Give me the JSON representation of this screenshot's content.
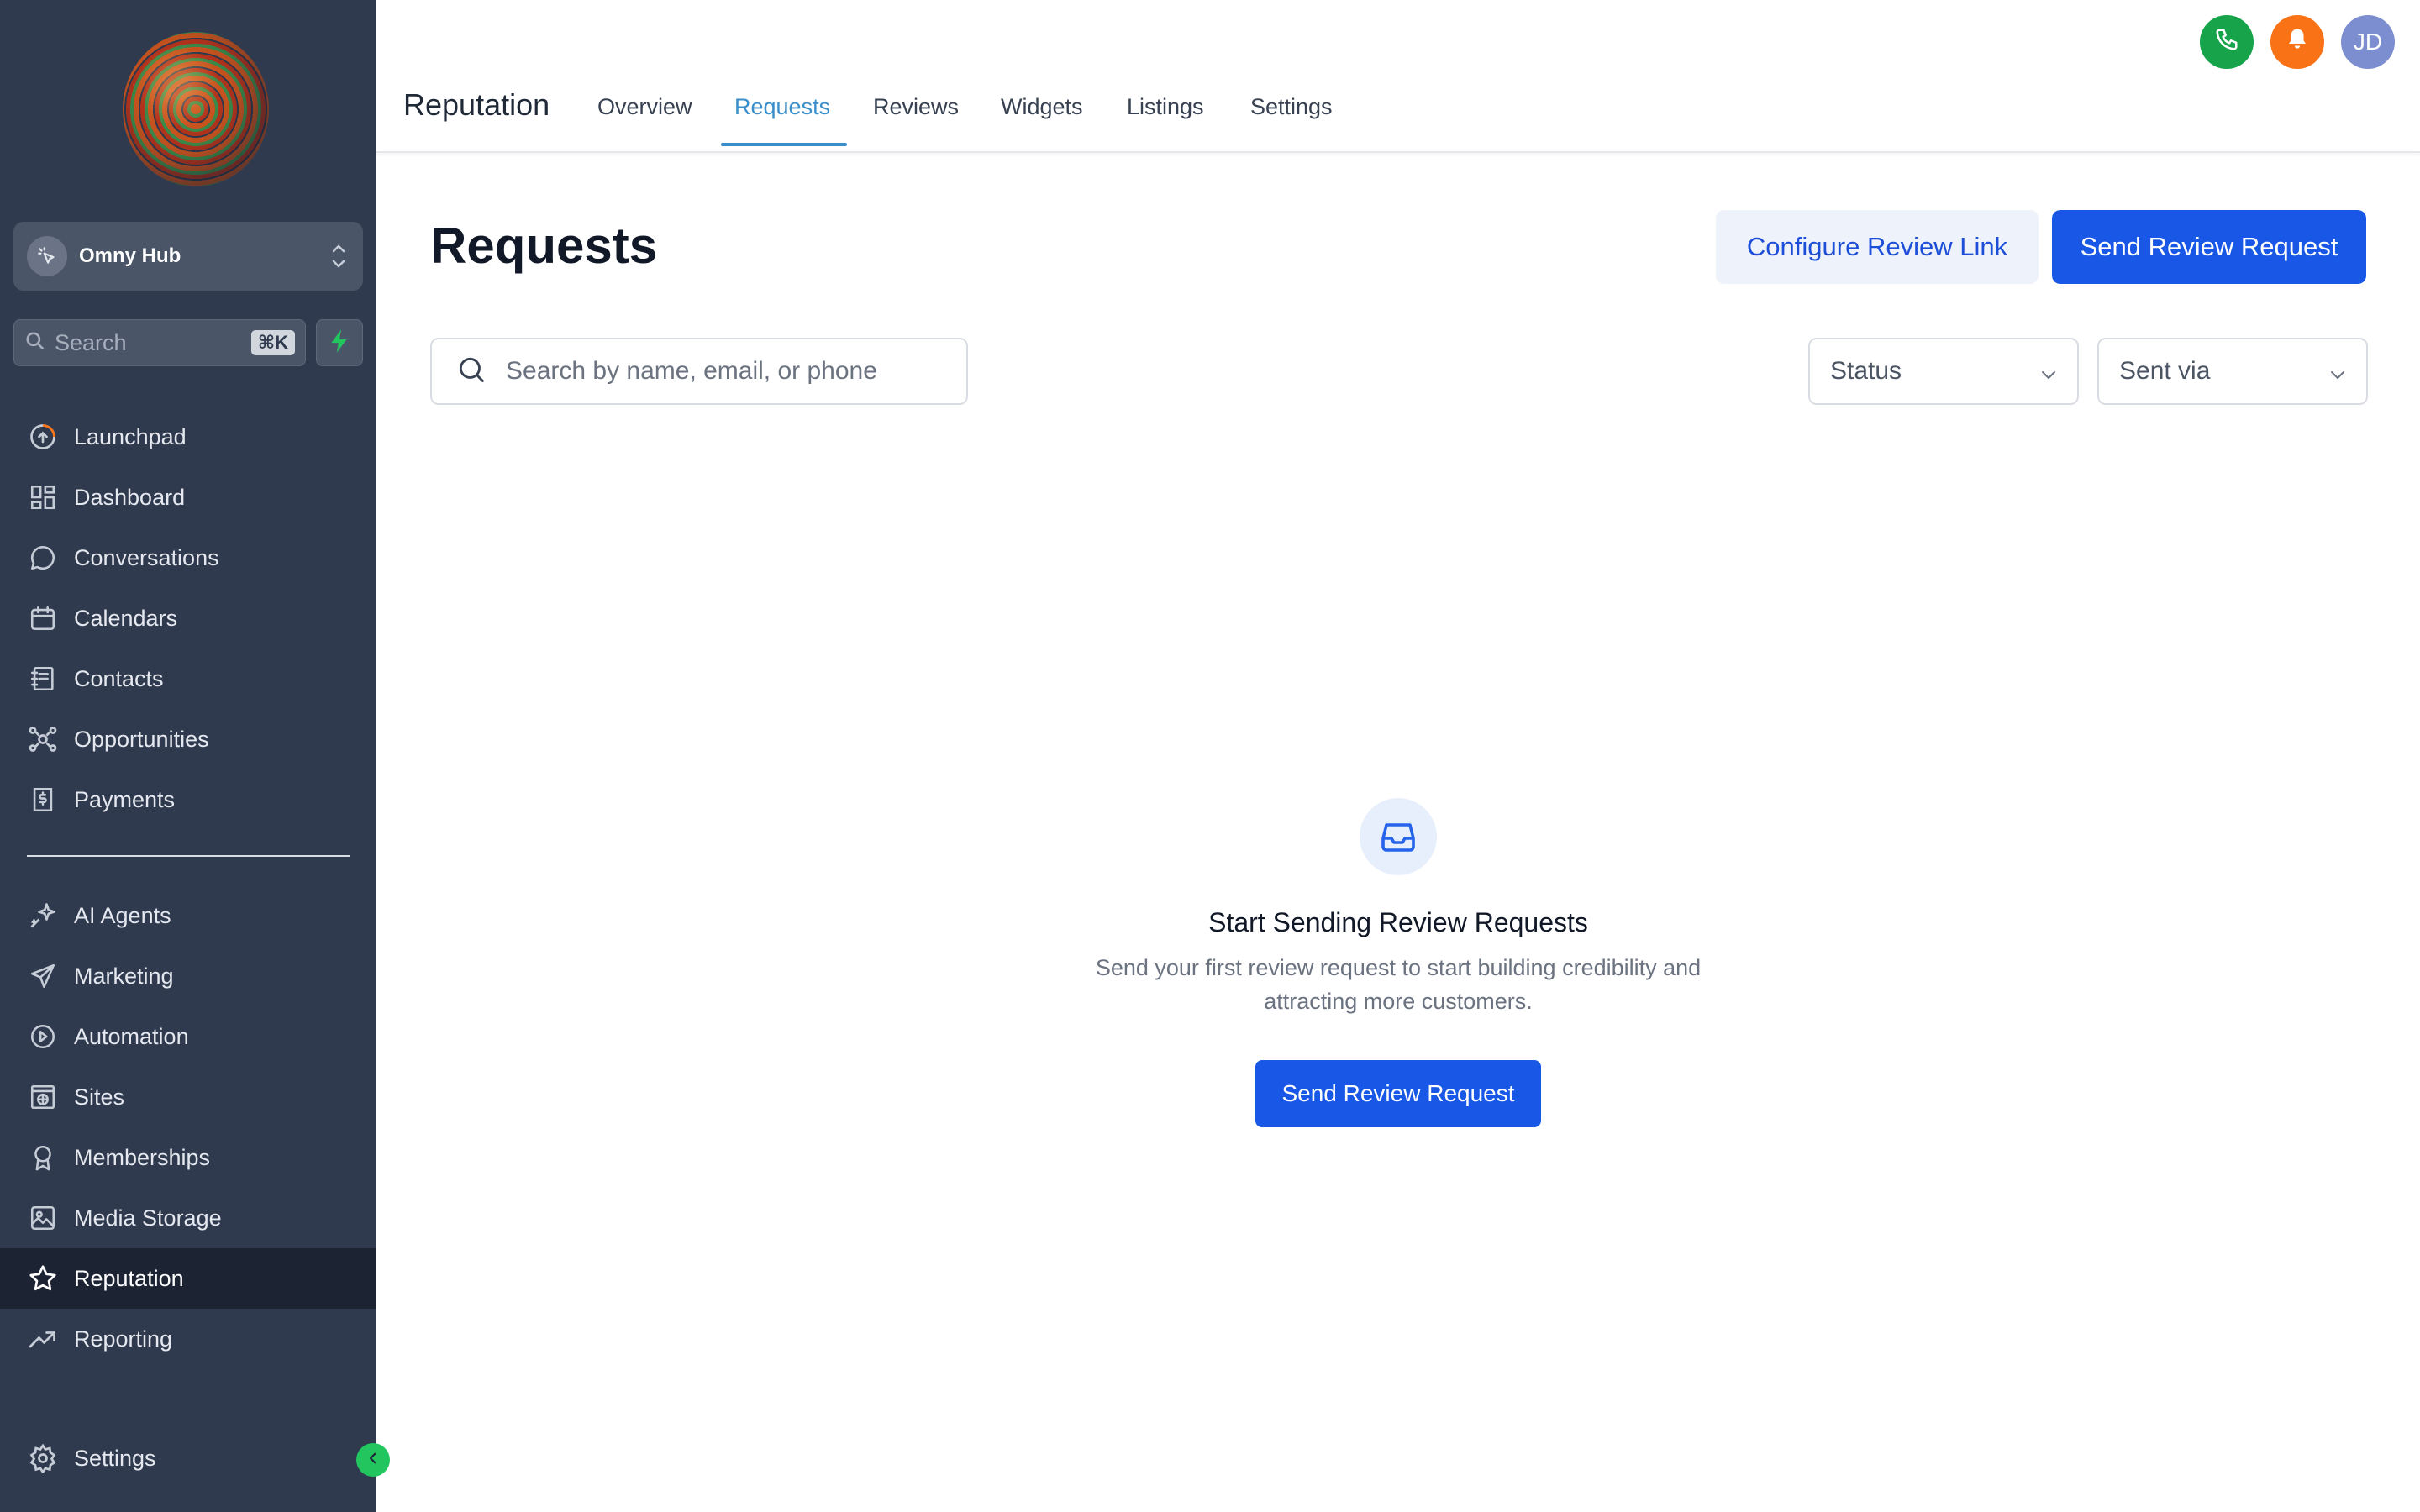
{
  "sidebar": {
    "account_name": "Omny Hub",
    "search_label": "Search",
    "search_shortcut": "⌘K",
    "nav_primary": [
      {
        "label": "Launchpad",
        "icon": "rocket-icon"
      },
      {
        "label": "Dashboard",
        "icon": "grid-icon"
      },
      {
        "label": "Conversations",
        "icon": "chat-icon"
      },
      {
        "label": "Calendars",
        "icon": "calendar-icon"
      },
      {
        "label": "Contacts",
        "icon": "contacts-icon"
      },
      {
        "label": "Opportunities",
        "icon": "opportunities-icon"
      },
      {
        "label": "Payments",
        "icon": "payments-icon"
      }
    ],
    "nav_secondary": [
      {
        "label": "AI Agents",
        "icon": "sparkle-icon"
      },
      {
        "label": "Marketing",
        "icon": "send-icon"
      },
      {
        "label": "Automation",
        "icon": "play-circle-icon"
      },
      {
        "label": "Sites",
        "icon": "globe-window-icon"
      },
      {
        "label": "Memberships",
        "icon": "badge-icon"
      },
      {
        "label": "Media Storage",
        "icon": "image-icon"
      },
      {
        "label": "Reputation",
        "icon": "star-icon",
        "active": true
      },
      {
        "label": "Reporting",
        "icon": "trend-icon"
      }
    ],
    "settings_label": "Settings",
    "accent_color": "#22c55e"
  },
  "header": {
    "module_title": "Reputation",
    "tabs": [
      {
        "label": "Overview"
      },
      {
        "label": "Requests",
        "active": true
      },
      {
        "label": "Reviews"
      },
      {
        "label": "Widgets"
      },
      {
        "label": "Listings"
      },
      {
        "label": "Settings"
      }
    ],
    "user_initials": "JD",
    "phone_color": "#16a34a",
    "bell_color": "#f97316",
    "avatar_color": "#7c8ed0"
  },
  "main": {
    "title": "Requests",
    "configure_button": "Configure Review Link",
    "send_button": "Send Review Request",
    "search_placeholder": "Search by name, email, or phone",
    "filters": {
      "status": "Status",
      "sent_via": "Sent via"
    },
    "empty_state": {
      "title": "Start Sending Review Requests",
      "description": "Send your first review request to start building credibility and attracting more customers.",
      "button": "Send Review Request"
    },
    "primary_color": "#1958e6"
  }
}
